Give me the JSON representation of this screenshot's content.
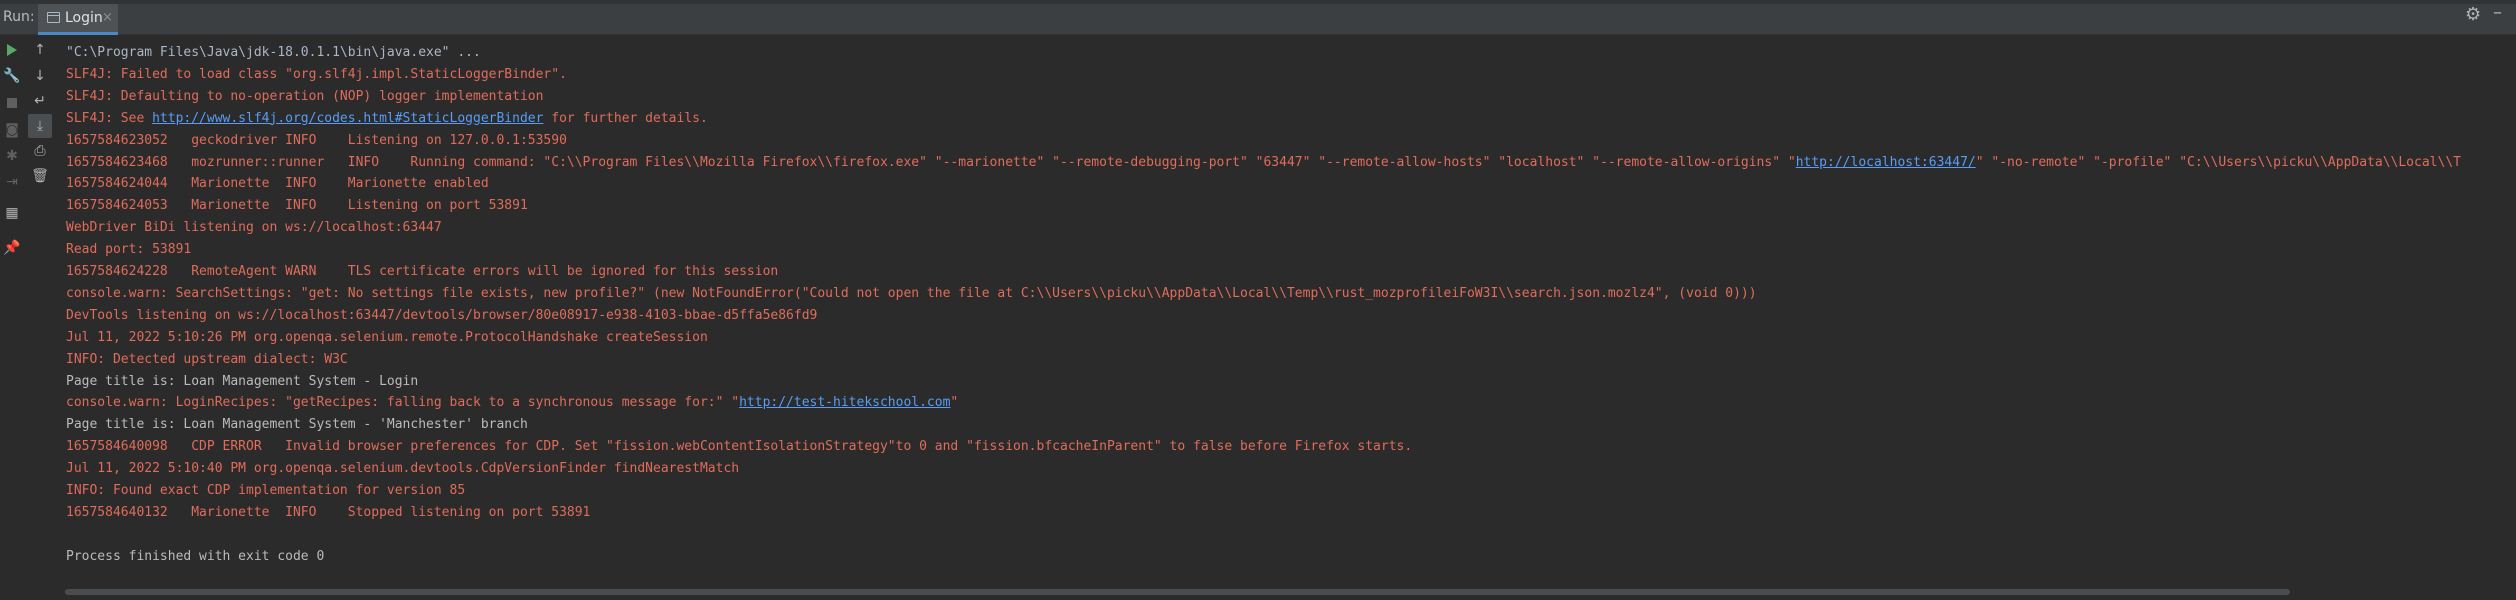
{
  "run_panel": {
    "label": "Run:",
    "tab_label": "Login",
    "tab_close": "×"
  },
  "right_icons": {
    "settings": "gear-icon",
    "minimize": "minimize-icon"
  },
  "toolbar": {
    "icons": [
      "rerun-icon",
      "wrench-icon",
      "stop-icon",
      "camera-icon",
      "bug-icon",
      "exit-icon",
      "layout-icon",
      "pin-icon"
    ],
    "icons2": [
      "up-arrow-icon",
      "down-arrow-icon",
      "soft-wrap-icon",
      "scroll-to-end-icon",
      "print-icon",
      "trash-icon"
    ]
  },
  "console": {
    "lines": [
      {
        "t": "\"C:\\Program Files\\Java\\jdk-18.0.1.1\\bin\\java.exe\" ...",
        "c": "gray"
      },
      {
        "t": "SLF4J: Failed to load class \"org.slf4j.impl.StaticLoggerBinder\".",
        "c": "red"
      },
      {
        "t": "SLF4J: Defaulting to no-operation (NOP) logger implementation",
        "c": "red"
      },
      {
        "t": "SLF4J: See ",
        "link": "http://www.slf4j.org/codes.html#StaticLoggerBinder",
        "after": " for further details.",
        "c": "red"
      },
      {
        "t": "1657584623052   geckodriver INFO    Listening on 127.0.0.1:53590",
        "c": "red"
      },
      {
        "t": "1657584623468   mozrunner::runner   INFO    Running command: \"C:\\\\Program Files\\\\Mozilla Firefox\\\\firefox.exe\" \"--marionette\" \"--remote-debugging-port\" \"63447\" \"--remote-allow-hosts\" \"localhost\" \"--remote-allow-origins\" \"",
        "link": "http://localhost:63447/",
        "after": "\" \"-no-remote\" \"-profile\" \"C:\\\\Users\\\\picku\\\\AppData\\\\Local\\\\T",
        "c": "red"
      },
      {
        "t": "1657584624044   Marionette  INFO    Marionette enabled",
        "c": "red"
      },
      {
        "t": "1657584624053   Marionette  INFO    Listening on port 53891",
        "c": "red"
      },
      {
        "t": "WebDriver BiDi listening on ws://localhost:63447",
        "c": "red"
      },
      {
        "t": "Read port: 53891",
        "c": "red"
      },
      {
        "t": "1657584624228   RemoteAgent WARN    TLS certificate errors will be ignored for this session",
        "c": "red"
      },
      {
        "t": "console.warn: SearchSettings: \"get: No settings file exists, new profile?\" (new NotFoundError(\"Could not open the file at C:\\\\Users\\\\picku\\\\AppData\\\\Local\\\\Temp\\\\rust_mozprofileiFoW3I\\\\search.json.mozlz4\", (void 0)))",
        "c": "red"
      },
      {
        "t": "DevTools listening on ws://localhost:63447/devtools/browser/80e08917-e938-4103-bbae-d5ffa5e86fd9",
        "c": "red"
      },
      {
        "t": "Jul 11, 2022 5:10:26 PM org.openqa.selenium.remote.ProtocolHandshake createSession",
        "c": "red"
      },
      {
        "t": "INFO: Detected upstream dialect: W3C",
        "c": "red"
      },
      {
        "t": "Page title is: Loan Management System - Login",
        "c": "plain"
      },
      {
        "t": "console.warn: LoginRecipes: \"getRecipes: falling back to a synchronous message for:\" \"",
        "link": "http://test-hitekschool.com",
        "after": "\"",
        "c": "red"
      },
      {
        "t": "Page title is: Loan Management System - 'Manchester' branch",
        "c": "plain"
      },
      {
        "t": "1657584640098   CDP ERROR   Invalid browser preferences for CDP. Set \"fission.webContentIsolationStrategy\"to 0 and \"fission.bfcacheInParent\" to false before Firefox starts.",
        "c": "red"
      },
      {
        "t": "Jul 11, 2022 5:10:40 PM org.openqa.selenium.devtools.CdpVersionFinder findNearestMatch",
        "c": "red"
      },
      {
        "t": "INFO: Found exact CDP implementation for version 85",
        "c": "red"
      },
      {
        "t": "1657584640132   Marionette  INFO    Stopped listening on port 53891",
        "c": "red"
      },
      {
        "t": "",
        "c": "plain"
      },
      {
        "t": "Process finished with exit code 0",
        "c": "plain"
      }
    ]
  }
}
